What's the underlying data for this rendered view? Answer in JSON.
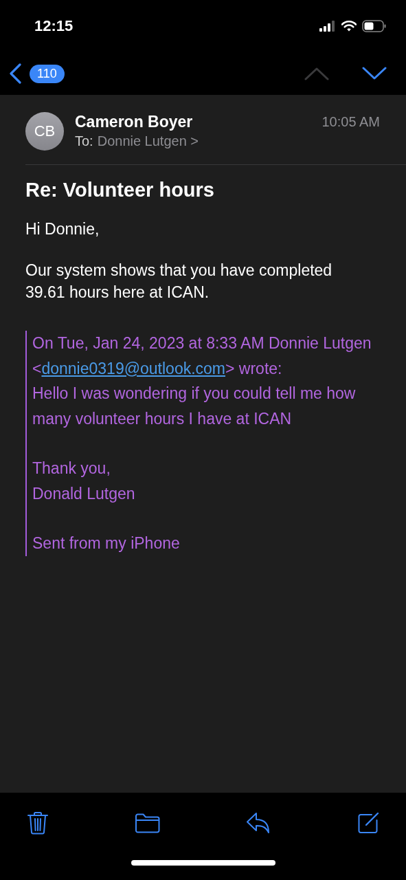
{
  "status_bar": {
    "time": "12:15"
  },
  "nav": {
    "unread_count": "110",
    "prev_disabled": true,
    "next_disabled": false
  },
  "message": {
    "sender_initials": "CB",
    "sender": "Cameron Boyer",
    "to_label": "To:",
    "recipient": "Donnie Lutgen",
    "chevron": ">",
    "time": "10:05 AM",
    "subject": "Re: Volunteer hours",
    "body": [
      "Hi Donnie,",
      "Our system shows that you have completed 39.61 hours here at ICAN."
    ],
    "quote": {
      "attribution_before": "On Tue, Jan 24, 2023 at 8:33 AM Donnie Lutgen <",
      "email_link": "donnie0319@outlook.com",
      "attribution_after": "> wrote:",
      "text": "Hello I was wondering if you could tell me how many volunteer hours I have at ICAN",
      "signoff": [
        "Thank you,",
        "Donald Lutgen"
      ],
      "signature": "Sent from my iPhone"
    }
  }
}
